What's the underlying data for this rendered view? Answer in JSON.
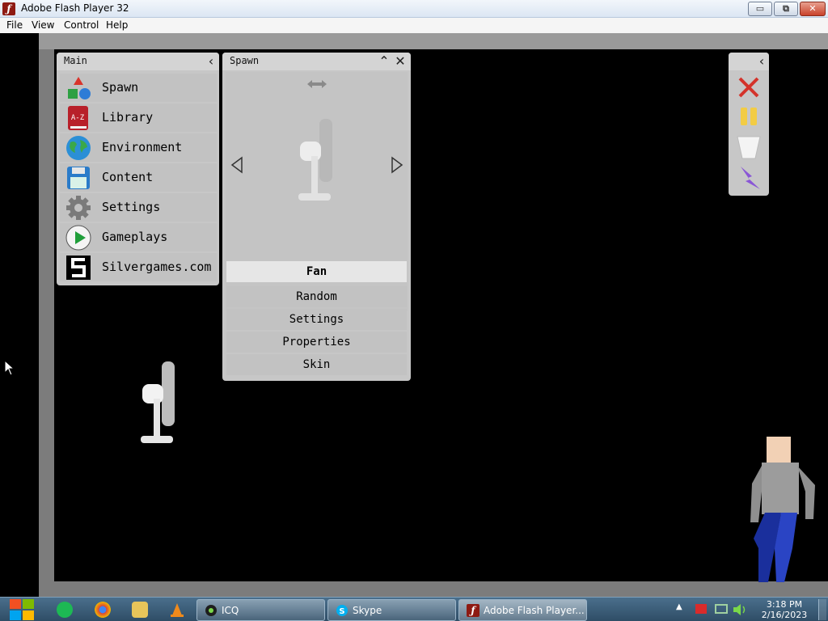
{
  "window": {
    "title": "Adobe Flash Player 32",
    "icon": "flash-f-icon",
    "controls": {
      "minimize": "▭",
      "maximize": "⧉",
      "close": "✕"
    }
  },
  "menubar": {
    "items": [
      "File",
      "View",
      "Control",
      "Help"
    ]
  },
  "main_panel": {
    "title": "Main",
    "collapse_glyph": "‹",
    "items": [
      {
        "label": "Spawn",
        "icon": "spawn-shapes-icon"
      },
      {
        "label": "Library",
        "icon": "library-book-icon"
      },
      {
        "label": "Environment",
        "icon": "globe-icon"
      },
      {
        "label": "Content",
        "icon": "floppy-disk-icon"
      },
      {
        "label": "Settings",
        "icon": "gear-icon"
      },
      {
        "label": "Gameplays",
        "icon": "play-icon"
      },
      {
        "label": "Silvergames.com",
        "icon": "silvergames-logo-icon"
      }
    ],
    "library_icon_text": "A-Z"
  },
  "spawn_panel": {
    "title": "Spawn",
    "minimize_glyph": "⌃",
    "close_glyph": "✕",
    "selected": "Fan",
    "options": [
      "Random",
      "Settings",
      "Properties",
      "Skin"
    ]
  },
  "toolbar": {
    "collapse_glyph": "‹",
    "tools": [
      "clear-x-icon",
      "pause-icon",
      "bucket-icon",
      "lightning-icon"
    ]
  },
  "taskbar": {
    "tasks": [
      {
        "label": "ICQ",
        "icon": "icq-icon"
      },
      {
        "label": "Skype",
        "icon": "skype-icon"
      },
      {
        "label": "Adobe Flash Player...",
        "icon": "flash-player-icon"
      }
    ],
    "clock": {
      "time": "3:18 PM",
      "date": "2/16/2023"
    }
  },
  "colors": {
    "panel": "#c7c7c7",
    "stage_bg": "#000000",
    "selected_option": "#e6e6e6",
    "taskbar": "#3c5f7b"
  }
}
